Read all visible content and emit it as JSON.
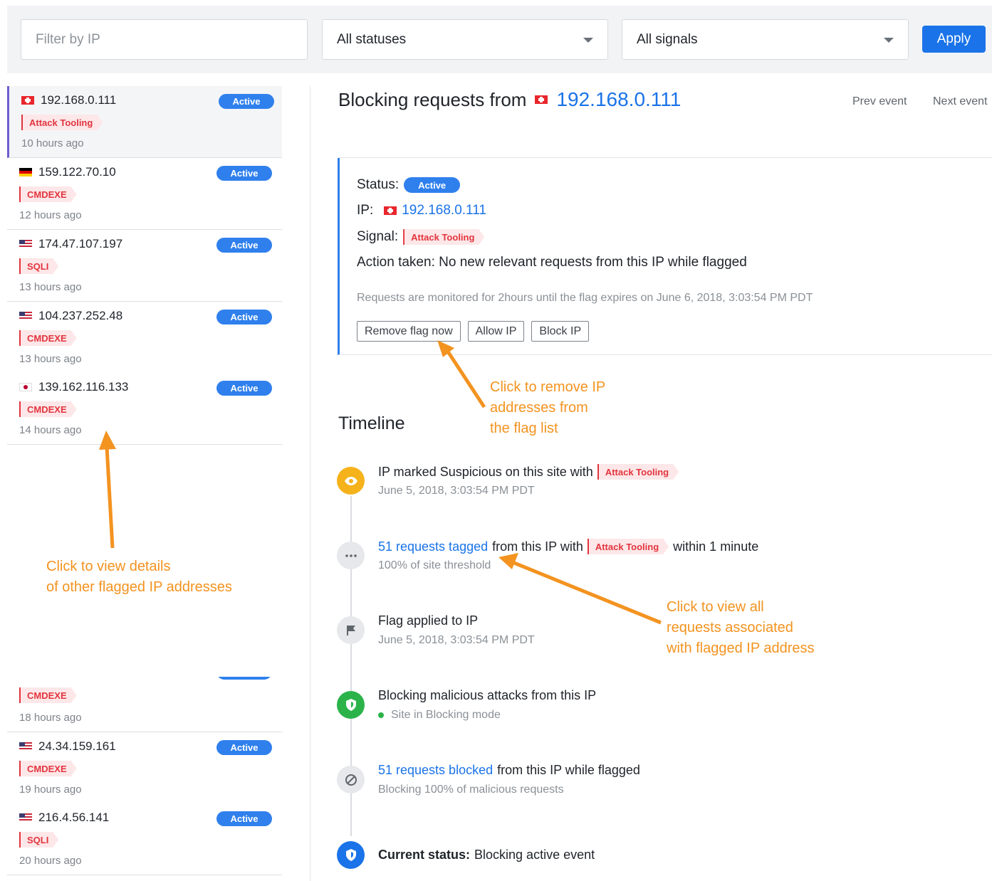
{
  "filters": {
    "ip_placeholder": "Filter by IP",
    "status_value": "All statuses",
    "signal_value": "All signals",
    "apply_label": "Apply"
  },
  "list": [
    {
      "flag": "ch",
      "ip": "192.168.0.111",
      "badge": "Active",
      "tag": "Attack Tooling",
      "time": "10 hours ago",
      "selected": true
    },
    {
      "flag": "de",
      "ip": "159.122.70.10",
      "badge": "Active",
      "tag": "CMDEXE",
      "time": "12 hours ago"
    },
    {
      "flag": "us",
      "ip": "174.47.107.197",
      "badge": "Active",
      "tag": "SQLI",
      "time": "13 hours ago"
    },
    {
      "flag": "us",
      "ip": "104.237.252.48",
      "badge": "Active",
      "tag": "CMDEXE",
      "time": "13 hours ago"
    },
    {
      "flag": "jp",
      "ip": "139.162.116.133",
      "badge": "Active",
      "tag": "CMDEXE",
      "time": "14 hours ago"
    },
    {
      "flag": "",
      "ip": "",
      "badge": "",
      "tag": "CMDEXE",
      "time": "18 hours ago"
    },
    {
      "flag": "us",
      "ip": "24.34.159.161",
      "badge": "Active",
      "tag": "CMDEXE",
      "time": "19 hours ago"
    },
    {
      "flag": "us",
      "ip": "216.4.56.141",
      "badge": "Active",
      "tag": "SQLI",
      "time": "20 hours ago"
    }
  ],
  "detail": {
    "title_prefix": "Blocking requests from",
    "ip": "192.168.0.111",
    "prev_label": "Prev event",
    "next_label": "Next event",
    "status_label": "Status:",
    "status_value": "Active",
    "ip_label": "IP:",
    "signal_label": "Signal:",
    "signal_value": "Attack Tooling",
    "action_text": "Action taken: No new relevant requests from this IP while flagged",
    "note": "Requests are monitored for 2hours until the flag expires on June 6, 2018, 3:03:54 PM PDT",
    "buttons": {
      "remove": "Remove flag now",
      "allow": "Allow IP",
      "block": "Block IP"
    }
  },
  "timeline": {
    "heading": "Timeline",
    "events": [
      {
        "icon": "eye-icon",
        "title": "IP marked Suspicious on this site with",
        "tag": "Attack Tooling",
        "sub": "June 5, 2018, 3:03:54 PM PDT"
      },
      {
        "icon": "more-icon",
        "link": "51 requests tagged",
        "title": "from this IP with",
        "tag": "Attack Tooling",
        "suffix": "within 1 minute",
        "sub": "100% of site threshold"
      },
      {
        "icon": "flag-icon",
        "title": "Flag applied to IP",
        "sub": "June 5, 2018, 3:03:54 PM PDT"
      },
      {
        "icon": "shield-icon",
        "title": "Blocking malicious attacks from this IP",
        "sub": "Site in Blocking mode"
      },
      {
        "icon": "block-icon",
        "link": "51 requests blocked",
        "title": "from this IP while flagged",
        "sub": "Blocking 100% of malicious requests"
      },
      {
        "icon": "shield-icon",
        "bold": "Current status:",
        "title": "Blocking active event"
      }
    ]
  },
  "annotations": {
    "remove_lines": [
      "Click to remove IP",
      "addresses from",
      "the flag list"
    ],
    "list_lines": [
      "Click to view details",
      "of other flagged IP addresses"
    ],
    "requests_lines": [
      "Click to view all",
      "requests associated",
      "with flagged IP address"
    ]
  },
  "colors": {
    "accent": "#1a73e8",
    "badge": "#2f80ed",
    "tag_text": "#e3343e",
    "tag_bg": "#fde7e8",
    "annotation": "#f39320",
    "selected_border": "#6f5ccf",
    "blocking_green": "#2bb34a",
    "suspicious_yellow": "#f5b21b"
  }
}
